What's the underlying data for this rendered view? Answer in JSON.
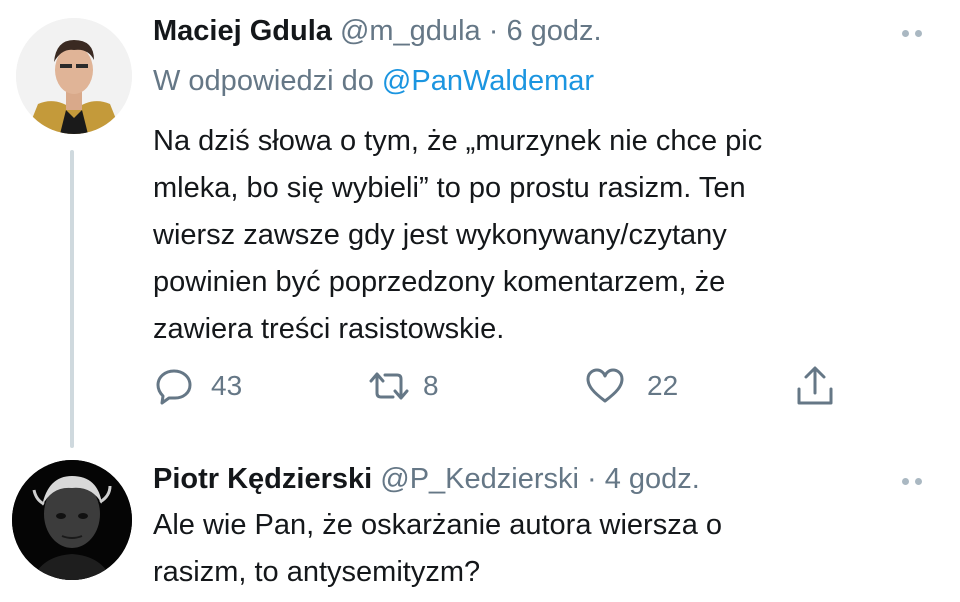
{
  "tweet1": {
    "name": "Maciej Gdula",
    "handle": "@m_gdula",
    "separator": "·",
    "time": "6 godz.",
    "reply_prefix": "W odpowiedzi do",
    "reply_mention": "@PanWaldemar",
    "body_lines": [
      "Na dziś słowa o tym, że „murzynek nie chce pic",
      "mleka, bo się wybieli” to po prostu rasizm. Ten",
      "wiersz zawsze gdy jest wykonywany/czytany",
      "powinien być poprzedzony komentarzem, że",
      "zawiera treści rasistowskie."
    ],
    "actions": {
      "reply_count": "43",
      "retweet_count": "8",
      "like_count": "22"
    }
  },
  "tweet2": {
    "name": "Piotr Kędzierski",
    "handle": "@P_Kedzierski",
    "separator": "·",
    "time": "4 godz.",
    "body_lines": [
      "Ale wie Pan, że oskarżanie autora wiersza o",
      "rasizm, to antysemityzm?"
    ]
  },
  "icons": {
    "reply": "reply-icon",
    "retweet": "retweet-icon",
    "like": "heart-icon",
    "share": "share-icon",
    "more": "more-icon"
  },
  "colors": {
    "text": "#14171a",
    "secondary": "#657786",
    "link": "#1b95e0",
    "thread_line": "#cfd9de"
  }
}
